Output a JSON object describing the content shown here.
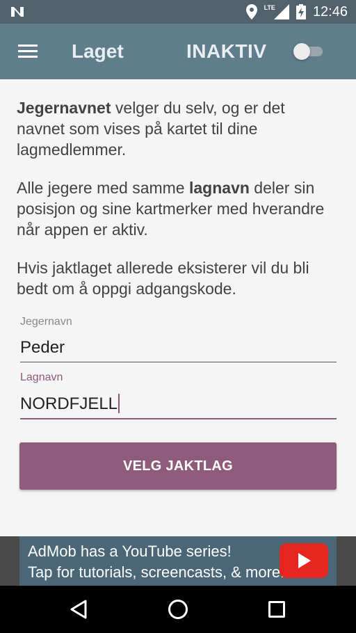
{
  "status_bar": {
    "time": "12:46",
    "network_label": "LTE",
    "icons": [
      "notification-n-icon",
      "location-icon",
      "signal-icon",
      "battery-charging-icon"
    ]
  },
  "app_bar": {
    "title": "Laget",
    "status_label": "INAKTIV",
    "toggle_on": false
  },
  "intro": {
    "p1_bold": "Jegernavnet",
    "p1_rest": " velger du selv, og er det navnet som vises på kartet til dine lagmedlemmer.",
    "p2_start": "Alle jegere med samme ",
    "p2_bold": "lagnavn",
    "p2_rest": " deler sin posisjon og sine kartmerker med hverandre når appen er aktiv.",
    "p3": "Hvis jaktlaget allerede eksisterer vil du bli bedt om å oppgi adgangskode."
  },
  "form": {
    "hunter_name_label": "Jegernavn",
    "hunter_name_value": "Peder",
    "team_name_label": "Lagnavn",
    "team_name_value": "NORDFJELL"
  },
  "primary_button": "VELG JAKTLAG",
  "ad": {
    "line1": "AdMob has a YouTube series!",
    "line2": "Tap for tutorials, screencasts, & more."
  },
  "colors": {
    "status_bar": "#52626d",
    "app_bar": "#607d8b",
    "accent": "#8e5c7a",
    "background": "#f5f5f5"
  }
}
